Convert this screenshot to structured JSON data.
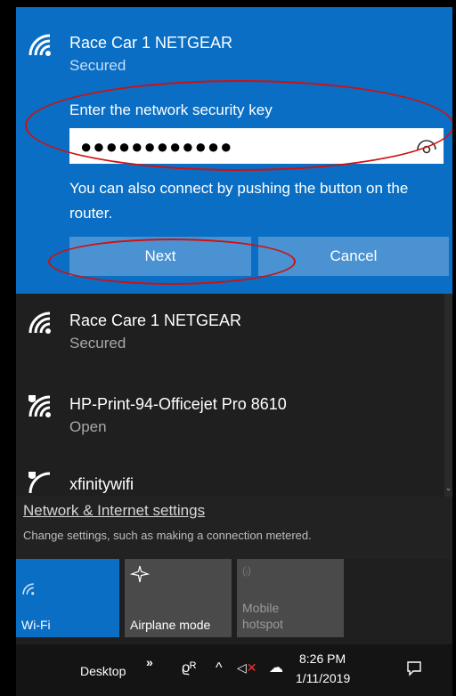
{
  "selected_network": {
    "name": "Race Car 1 NETGEAR",
    "status": "Secured",
    "key_label": "Enter the network security key",
    "key_value": "●●●●●●●●●●●●",
    "push_message": "You can also connect by pushing the button on the router.",
    "next_label": "Next",
    "cancel_label": "Cancel"
  },
  "networks": [
    {
      "name": "Race Care 1 NETGEAR",
      "status": "Secured"
    },
    {
      "name": "HP-Print-94-Officejet Pro 8610",
      "status": "Open"
    },
    {
      "name": "xfinitywifi",
      "status": ""
    }
  ],
  "settings": {
    "link": "Network & Internet settings",
    "description": "Change settings, such as making a connection metered."
  },
  "quick_actions": [
    {
      "label": "Wi-Fi",
      "state": "on",
      "icon": "wifi-icon"
    },
    {
      "label": "Airplane mode",
      "state": "off",
      "icon": "airplane-icon"
    },
    {
      "label": "Mobile hotspot",
      "state": "disabled",
      "icon": "hotspot-icon"
    }
  ],
  "taskbar": {
    "desktop_label": "Desktop",
    "overflow": "»",
    "time": "8:26 PM",
    "date": "1/11/2019"
  },
  "colors": {
    "accent": "#0a6ec4",
    "annotation": "#d01010"
  }
}
